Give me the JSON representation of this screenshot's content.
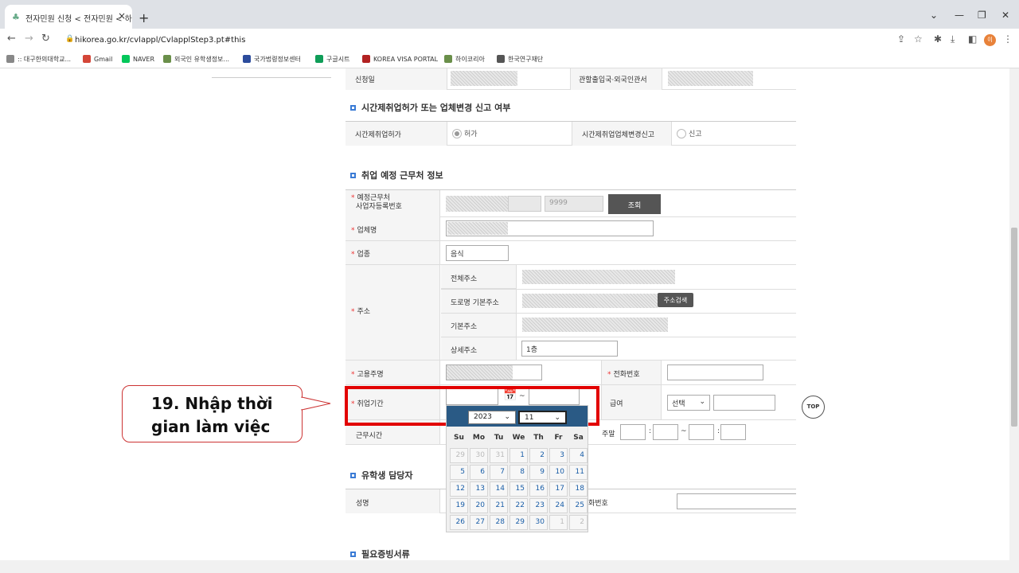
{
  "browser": {
    "tab_title": "전자민원 신청 < 전자민원 < 하",
    "tab_close": "×",
    "new_tab": "+",
    "url": "hikorea.go.kr/cvlappl/CvlapplStep3.pt#this",
    "avatar": "이",
    "window_controls": [
      "⌄",
      "—",
      "❐",
      "✕"
    ]
  },
  "bookmarks": [
    {
      "label": ":: 대구한의대학교...",
      "color": "#888888"
    },
    {
      "label": "Gmail",
      "color": "#d44638"
    },
    {
      "label": "NAVER",
      "color": "#03c75a"
    },
    {
      "label": "외국인 유학생정보...",
      "color": "#6a8f4a"
    },
    {
      "label": "국가법령정보센터",
      "color": "#2c4c9c"
    },
    {
      "label": "구글시트",
      "color": "#0f9d58"
    },
    {
      "label": "KOREA VISA PORTAL",
      "color": "#b22222"
    },
    {
      "label": "하이코리아",
      "color": "#6a8f4a"
    },
    {
      "label": "한국연구재단",
      "color": "#555555"
    }
  ],
  "form": {
    "apply_date_label": "신청일",
    "office_label": "관할출입국·외국인관서",
    "section1_title": "시간제취업허가 또는 업체변경 신고 여부",
    "parttime_permit_label": "시간제취업허가",
    "permit_option": "허가",
    "change_report_label": "시간제취업업체변경신고",
    "report_option": "신고",
    "section2_title": "취업 예정 근무처 정보",
    "bizno_label_1": "예정근무처",
    "bizno_label_2": "사업자등록번호",
    "bizno_suffix": "9999",
    "lookup_button": "조회",
    "company_label": "업체명",
    "industry_label": "업종",
    "industry_value": "음식",
    "address_label": "주소",
    "full_address_label": "전체주소",
    "road_address_label": "도로명 기본주소",
    "address_search_button": "주소검색",
    "basic_address_label": "기본주소",
    "detail_address_label": "상세주소",
    "detail_address_value": "1층",
    "employer_label": "고용주명",
    "phone_label": "전화번호",
    "period_label": "취업기간",
    "period_sep": "~",
    "salary_label": "급여",
    "salary_select": "선택",
    "hours_label": "근무시간",
    "weekend_label": "주말",
    "time_colon": ":",
    "time_sep": "~",
    "section3_title": "유학생 담당자",
    "name_label": "성명",
    "manager_phone_label": "화번호",
    "section4_title": "필요증빙서류",
    "top_button": "TOP"
  },
  "calendar": {
    "year": "2023",
    "month": "11",
    "weekdays": [
      "Su",
      "Mo",
      "Tu",
      "We",
      "Th",
      "Fr",
      "Sa"
    ],
    "weeks": [
      [
        "29",
        "30",
        "31",
        "1",
        "2",
        "3",
        "4"
      ],
      [
        "5",
        "6",
        "7",
        "8",
        "9",
        "10",
        "11"
      ],
      [
        "12",
        "13",
        "14",
        "15",
        "16",
        "17",
        "18"
      ],
      [
        "19",
        "20",
        "21",
        "22",
        "23",
        "24",
        "25"
      ],
      [
        "26",
        "27",
        "28",
        "29",
        "30",
        "1",
        "2"
      ]
    ]
  },
  "annotation": {
    "line1": "19. Nhập thời",
    "line2": "gian làm việc"
  }
}
